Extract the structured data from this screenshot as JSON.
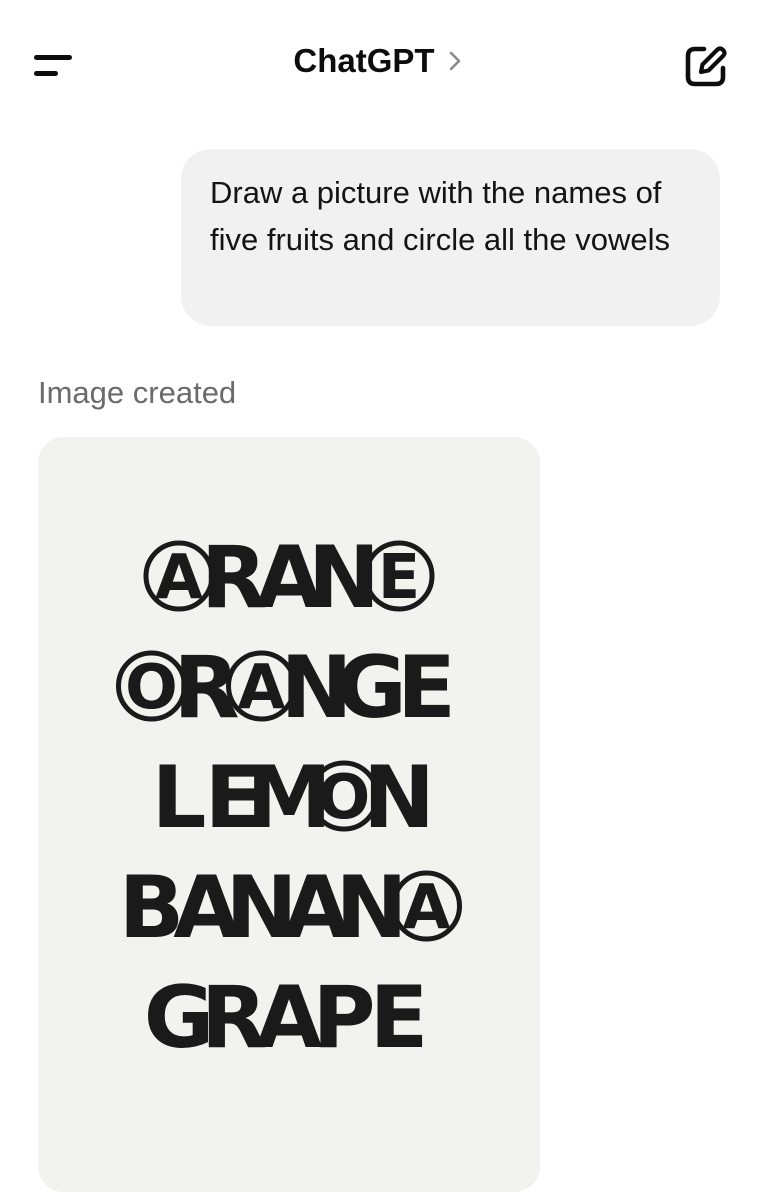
{
  "header": {
    "menu_icon": "menu-icon",
    "title": "ChatGPT",
    "title_chevron_icon": "chevron-right-icon",
    "compose_icon": "edit-pencil-icon"
  },
  "conversation": {
    "user_message": "Draw a picture with the names of five fruits and circle all the vowels",
    "assistant": {
      "status": "Image created",
      "generated_image": {
        "background_color": "#f2f2ee",
        "ink_color": "#1a1a1a",
        "words": [
          "ARANE",
          "ORANGE",
          "LEMON",
          "BANANA",
          "GRAPE"
        ],
        "circled_letter_indices": [
          [
            0,
            4
          ],
          [
            0,
            2
          ],
          [
            3
          ],
          [
            5
          ],
          []
        ]
      }
    }
  },
  "colors": {
    "bubble_background": "#f1f1f1",
    "status_text": "#6b6b6b",
    "text": "#0d0d0d"
  }
}
